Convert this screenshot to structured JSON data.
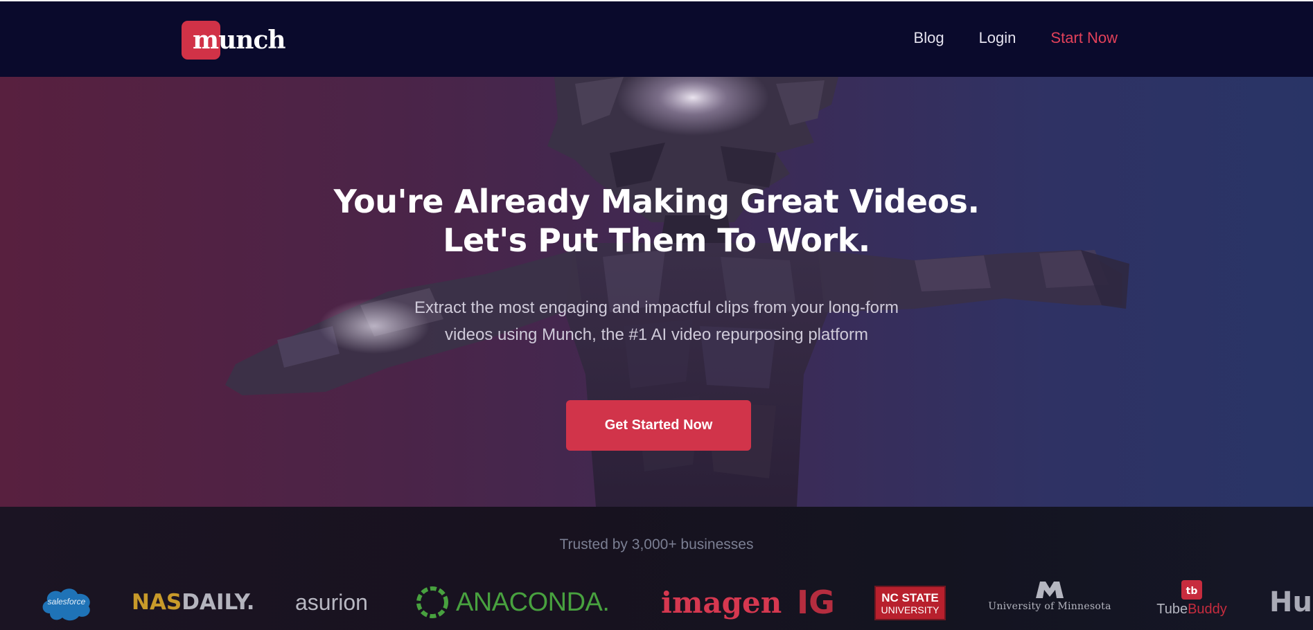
{
  "nav": {
    "logo_text": "munch",
    "links": [
      {
        "label": "Blog"
      },
      {
        "label": "Login"
      },
      {
        "label": "Start Now"
      }
    ]
  },
  "hero": {
    "headline_line1": "You're Already Making Great Videos.",
    "headline_line2": "Let's Put Them To Work.",
    "subhead_line1": "Extract the most engaging and impactful clips from your long-form",
    "subhead_line2": "videos using Munch, the #1 AI video repurposing platform",
    "cta_label": "Get Started Now"
  },
  "trusted": {
    "title": "Trusted by 3,000+ businesses",
    "logos": {
      "salesforce": "salesforce",
      "nasdaily_part1": "NAS",
      "nasdaily_part2": "DAILY.",
      "asurion": "asurion",
      "anaconda": "ANACONDA.",
      "imagen": "imagen",
      "ig": "IG",
      "ncstate_line1": "NC STATE",
      "ncstate_line2": "UNIVERSITY",
      "umn": "University of Minnesota",
      "tubebuddy_part1": "Tube",
      "tubebuddy_part2": "Buddy",
      "hub": "Hub"
    }
  },
  "colors": {
    "nav_bg": "#0a0a2c",
    "accent": "#d1344a",
    "hero_left": "#58203f",
    "hero_right": "#293466"
  }
}
